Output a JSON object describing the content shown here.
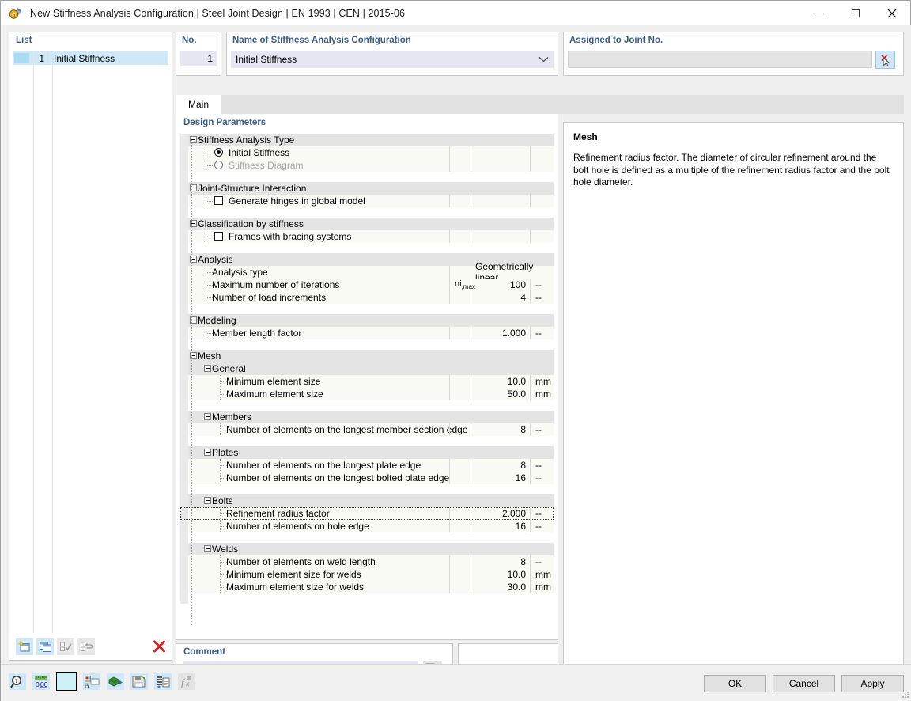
{
  "window": {
    "title": "New Stiffness Analysis Configuration | Steel Joint Design | EN 1993 | CEN | 2015-06",
    "icon": "app-icon",
    "minimize": "—",
    "maximize": "□",
    "close": "✕"
  },
  "list": {
    "header": "List",
    "rows": [
      {
        "num": "1",
        "name": "Initial Stiffness"
      }
    ],
    "tools": [
      {
        "name": "new-item-button",
        "enabled": true
      },
      {
        "name": "copy-item-button",
        "enabled": true
      },
      {
        "name": "select-all-button",
        "enabled": false
      },
      {
        "name": "deselect-all-button",
        "enabled": false
      },
      {
        "name": "delete-item-button",
        "enabled": true,
        "label": "✕"
      }
    ]
  },
  "number_field": {
    "label": "No.",
    "value": "1"
  },
  "name_field": {
    "label": "Name of Stiffness Analysis Configuration",
    "value": "Initial Stiffness",
    "placeholder": ""
  },
  "assigned_field": {
    "label": "Assigned to Joint No.",
    "value": "",
    "placeholder": "",
    "pick_button": "select-joint-button"
  },
  "tabs": [
    {
      "label": "Main",
      "active": true
    }
  ],
  "design_parameters": {
    "title": "Design Parameters",
    "rows": [
      {
        "kind": "group",
        "level": 0,
        "label": "Stiffness Analysis Type"
      },
      {
        "kind": "radio",
        "level": 1,
        "label": "Initial Stiffness",
        "checked": true,
        "disabled": false
      },
      {
        "kind": "radio",
        "level": 1,
        "label": "Stiffness Diagram",
        "checked": false,
        "disabled": true
      },
      {
        "kind": "blank"
      },
      {
        "kind": "group",
        "level": 0,
        "label": "Joint-Structure Interaction"
      },
      {
        "kind": "check",
        "level": 1,
        "label": "Generate hinges in global model",
        "checked": false
      },
      {
        "kind": "blank"
      },
      {
        "kind": "group",
        "level": 0,
        "label": "Classification by stiffness"
      },
      {
        "kind": "check",
        "level": 1,
        "label": "Frames with bracing systems",
        "checked": false
      },
      {
        "kind": "blank"
      },
      {
        "kind": "group",
        "level": 0,
        "label": "Analysis"
      },
      {
        "kind": "value",
        "level": 1,
        "label": "Analysis type",
        "symbol": "",
        "value": "Geometrically linear",
        "unit": "",
        "span": true
      },
      {
        "kind": "value",
        "level": 1,
        "label": "Maximum number of iterations",
        "symbol": "ni,max",
        "value": "100",
        "unit": "--"
      },
      {
        "kind": "value",
        "level": 1,
        "label": "Number of load increments",
        "symbol": "",
        "value": "4",
        "unit": "--"
      },
      {
        "kind": "blank"
      },
      {
        "kind": "group",
        "level": 0,
        "label": "Modeling"
      },
      {
        "kind": "value",
        "level": 1,
        "label": "Member length factor",
        "symbol": "",
        "value": "1.000",
        "unit": "--"
      },
      {
        "kind": "blank"
      },
      {
        "kind": "group",
        "level": 0,
        "label": "Mesh"
      },
      {
        "kind": "group",
        "level": 1,
        "label": "General"
      },
      {
        "kind": "value",
        "level": 2,
        "label": "Minimum element size",
        "symbol": "",
        "value": "10.0",
        "unit": "mm"
      },
      {
        "kind": "value",
        "level": 2,
        "label": "Maximum element size",
        "symbol": "",
        "value": "50.0",
        "unit": "mm"
      },
      {
        "kind": "blank"
      },
      {
        "kind": "group",
        "level": 1,
        "label": "Members"
      },
      {
        "kind": "value",
        "level": 2,
        "label": "Number of elements on the longest member section edge",
        "symbol": "",
        "value": "8",
        "unit": "--"
      },
      {
        "kind": "blank"
      },
      {
        "kind": "group",
        "level": 1,
        "label": "Plates"
      },
      {
        "kind": "value",
        "level": 2,
        "label": "Number of elements on the longest plate edge",
        "symbol": "",
        "value": "8",
        "unit": "--"
      },
      {
        "kind": "value",
        "level": 2,
        "label": "Number of elements on the longest bolted plate edge",
        "symbol": "",
        "value": "16",
        "unit": "--"
      },
      {
        "kind": "blank"
      },
      {
        "kind": "group",
        "level": 1,
        "label": "Bolts"
      },
      {
        "kind": "value",
        "level": 2,
        "label": "Refinement radius factor",
        "symbol": "",
        "value": "2.000",
        "unit": "--",
        "focused": true
      },
      {
        "kind": "value",
        "level": 2,
        "label": "Number of elements on hole edge",
        "symbol": "",
        "value": "16",
        "unit": "--"
      },
      {
        "kind": "blank"
      },
      {
        "kind": "group",
        "level": 1,
        "label": "Welds"
      },
      {
        "kind": "value",
        "level": 2,
        "label": "Number of elements on weld length",
        "symbol": "",
        "value": "8",
        "unit": "--"
      },
      {
        "kind": "value",
        "level": 2,
        "label": "Minimum element size for welds",
        "symbol": "",
        "value": "10.0",
        "unit": "mm"
      },
      {
        "kind": "value",
        "level": 2,
        "label": "Maximum element size for welds",
        "symbol": "",
        "value": "30.0",
        "unit": "mm"
      },
      {
        "kind": "blank"
      }
    ]
  },
  "comment": {
    "label": "Comment",
    "value": "",
    "placeholder": "",
    "button": "comment-library-button"
  },
  "info": {
    "heading": "Mesh",
    "text": "Refinement radius factor. The diameter of circular refinement around the bolt hole is defined as a multiple of the refinement radius factor and the bolt hole diameter."
  },
  "bottom_toolbar": [
    {
      "name": "zoom-info-icon",
      "enabled": true
    },
    {
      "name": "units-decimals-icon",
      "enabled": true
    },
    {
      "name": "color-swatch-icon",
      "enabled": true
    },
    {
      "name": "display-properties-icon",
      "enabled": true
    },
    {
      "name": "import-icon",
      "enabled": true
    },
    {
      "name": "save-config-icon",
      "enabled": true
    },
    {
      "name": "copy-list-icon",
      "enabled": true
    },
    {
      "name": "formula-icon",
      "enabled": false
    }
  ],
  "dialog_buttons": [
    {
      "label": "OK",
      "name": "ok-button"
    },
    {
      "label": "Cancel",
      "name": "cancel-button"
    },
    {
      "label": "Apply",
      "name": "apply-button"
    }
  ],
  "colors": {
    "accent_label": "#3b5a8c",
    "selection": "#cfe8f7",
    "field": "#e6e6f2",
    "row_alt": "#fafaf4",
    "group_header": "#e4e4e4",
    "delete_red": "#d81e1e"
  }
}
